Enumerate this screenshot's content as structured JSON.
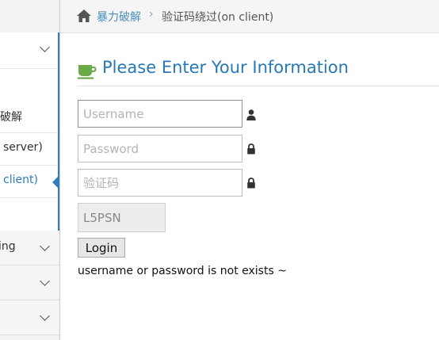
{
  "breadcrumb": {
    "parent": "暴力破解",
    "separator": "›",
    "current": "验证码绕过(on client)"
  },
  "sidebar": {
    "sub_items": [
      {
        "label": "力破解"
      },
      {
        "label": "server)"
      },
      {
        "label": "client)"
      }
    ],
    "groups": [
      {
        "label": "ing"
      },
      {
        "label": ""
      },
      {
        "label": ""
      }
    ]
  },
  "main": {
    "title": "Please Enter Your Information",
    "username_placeholder": "Username",
    "password_placeholder": "Password",
    "vcode_placeholder": "验证码",
    "captcha_text": "L5PSN",
    "login_label": "Login",
    "message": "username or password is not exists ~"
  },
  "colors": {
    "accent": "#2679b5",
    "link": "#4c8fbd",
    "cup": "#69aa46"
  },
  "icons": {
    "home": "home-icon",
    "cup": "coffee-cup-icon",
    "user": "user-icon",
    "lock": "lock-icon",
    "chevron": "chevron-down-icon"
  }
}
